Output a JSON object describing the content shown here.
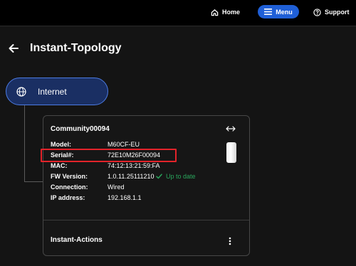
{
  "topnav": {
    "home": "Home",
    "menu": "Menu",
    "support": "Support"
  },
  "page": {
    "title": "Instant-Topology"
  },
  "internet": {
    "label": "Internet"
  },
  "device": {
    "name": "Community00094",
    "rows": [
      {
        "key": "Model:",
        "value": "M60CF-EU"
      },
      {
        "key": "Serial#:",
        "value": "72E10M26F00094"
      },
      {
        "key": "MAC:",
        "value": "74:12:13:21:59:FA"
      },
      {
        "key": "FW Version:",
        "value": "1.0.11.25111210"
      },
      {
        "key": "Connection:",
        "value": "Wired"
      },
      {
        "key": "IP address:",
        "value": "192.168.1.1"
      }
    ],
    "fw_status": "Up to date",
    "actions_label": "Instant-Actions"
  },
  "colors": {
    "accent": "#1f5fd6",
    "highlight": "#e3232a",
    "ok": "#29a55c"
  }
}
